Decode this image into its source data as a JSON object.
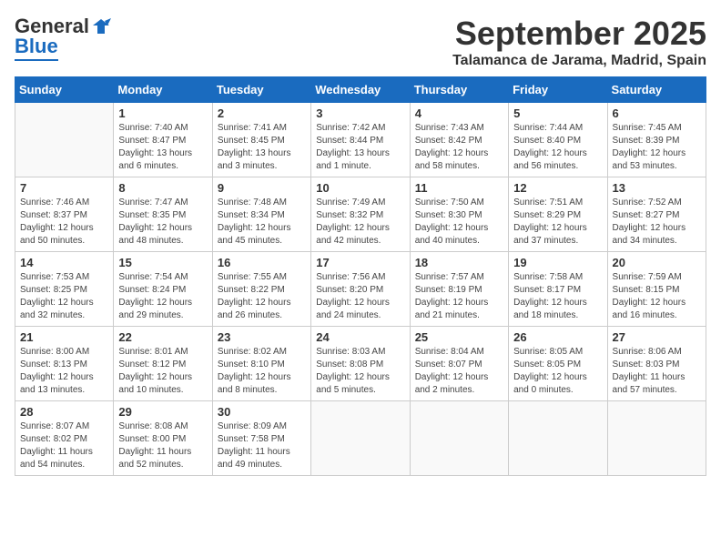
{
  "header": {
    "logo_general": "General",
    "logo_blue": "Blue",
    "month": "September 2025",
    "location": "Talamanca de Jarama, Madrid, Spain"
  },
  "weekdays": [
    "Sunday",
    "Monday",
    "Tuesday",
    "Wednesday",
    "Thursday",
    "Friday",
    "Saturday"
  ],
  "weeks": [
    [
      {
        "num": "",
        "empty": true
      },
      {
        "num": "1",
        "sunrise": "Sunrise: 7:40 AM",
        "sunset": "Sunset: 8:47 PM",
        "daylight": "Daylight: 13 hours and 6 minutes."
      },
      {
        "num": "2",
        "sunrise": "Sunrise: 7:41 AM",
        "sunset": "Sunset: 8:45 PM",
        "daylight": "Daylight: 13 hours and 3 minutes."
      },
      {
        "num": "3",
        "sunrise": "Sunrise: 7:42 AM",
        "sunset": "Sunset: 8:44 PM",
        "daylight": "Daylight: 13 hours and 1 minute."
      },
      {
        "num": "4",
        "sunrise": "Sunrise: 7:43 AM",
        "sunset": "Sunset: 8:42 PM",
        "daylight": "Daylight: 12 hours and 58 minutes."
      },
      {
        "num": "5",
        "sunrise": "Sunrise: 7:44 AM",
        "sunset": "Sunset: 8:40 PM",
        "daylight": "Daylight: 12 hours and 56 minutes."
      },
      {
        "num": "6",
        "sunrise": "Sunrise: 7:45 AM",
        "sunset": "Sunset: 8:39 PM",
        "daylight": "Daylight: 12 hours and 53 minutes."
      }
    ],
    [
      {
        "num": "7",
        "sunrise": "Sunrise: 7:46 AM",
        "sunset": "Sunset: 8:37 PM",
        "daylight": "Daylight: 12 hours and 50 minutes."
      },
      {
        "num": "8",
        "sunrise": "Sunrise: 7:47 AM",
        "sunset": "Sunset: 8:35 PM",
        "daylight": "Daylight: 12 hours and 48 minutes."
      },
      {
        "num": "9",
        "sunrise": "Sunrise: 7:48 AM",
        "sunset": "Sunset: 8:34 PM",
        "daylight": "Daylight: 12 hours and 45 minutes."
      },
      {
        "num": "10",
        "sunrise": "Sunrise: 7:49 AM",
        "sunset": "Sunset: 8:32 PM",
        "daylight": "Daylight: 12 hours and 42 minutes."
      },
      {
        "num": "11",
        "sunrise": "Sunrise: 7:50 AM",
        "sunset": "Sunset: 8:30 PM",
        "daylight": "Daylight: 12 hours and 40 minutes."
      },
      {
        "num": "12",
        "sunrise": "Sunrise: 7:51 AM",
        "sunset": "Sunset: 8:29 PM",
        "daylight": "Daylight: 12 hours and 37 minutes."
      },
      {
        "num": "13",
        "sunrise": "Sunrise: 7:52 AM",
        "sunset": "Sunset: 8:27 PM",
        "daylight": "Daylight: 12 hours and 34 minutes."
      }
    ],
    [
      {
        "num": "14",
        "sunrise": "Sunrise: 7:53 AM",
        "sunset": "Sunset: 8:25 PM",
        "daylight": "Daylight: 12 hours and 32 minutes."
      },
      {
        "num": "15",
        "sunrise": "Sunrise: 7:54 AM",
        "sunset": "Sunset: 8:24 PM",
        "daylight": "Daylight: 12 hours and 29 minutes."
      },
      {
        "num": "16",
        "sunrise": "Sunrise: 7:55 AM",
        "sunset": "Sunset: 8:22 PM",
        "daylight": "Daylight: 12 hours and 26 minutes."
      },
      {
        "num": "17",
        "sunrise": "Sunrise: 7:56 AM",
        "sunset": "Sunset: 8:20 PM",
        "daylight": "Daylight: 12 hours and 24 minutes."
      },
      {
        "num": "18",
        "sunrise": "Sunrise: 7:57 AM",
        "sunset": "Sunset: 8:19 PM",
        "daylight": "Daylight: 12 hours and 21 minutes."
      },
      {
        "num": "19",
        "sunrise": "Sunrise: 7:58 AM",
        "sunset": "Sunset: 8:17 PM",
        "daylight": "Daylight: 12 hours and 18 minutes."
      },
      {
        "num": "20",
        "sunrise": "Sunrise: 7:59 AM",
        "sunset": "Sunset: 8:15 PM",
        "daylight": "Daylight: 12 hours and 16 minutes."
      }
    ],
    [
      {
        "num": "21",
        "sunrise": "Sunrise: 8:00 AM",
        "sunset": "Sunset: 8:13 PM",
        "daylight": "Daylight: 12 hours and 13 minutes."
      },
      {
        "num": "22",
        "sunrise": "Sunrise: 8:01 AM",
        "sunset": "Sunset: 8:12 PM",
        "daylight": "Daylight: 12 hours and 10 minutes."
      },
      {
        "num": "23",
        "sunrise": "Sunrise: 8:02 AM",
        "sunset": "Sunset: 8:10 PM",
        "daylight": "Daylight: 12 hours and 8 minutes."
      },
      {
        "num": "24",
        "sunrise": "Sunrise: 8:03 AM",
        "sunset": "Sunset: 8:08 PM",
        "daylight": "Daylight: 12 hours and 5 minutes."
      },
      {
        "num": "25",
        "sunrise": "Sunrise: 8:04 AM",
        "sunset": "Sunset: 8:07 PM",
        "daylight": "Daylight: 12 hours and 2 minutes."
      },
      {
        "num": "26",
        "sunrise": "Sunrise: 8:05 AM",
        "sunset": "Sunset: 8:05 PM",
        "daylight": "Daylight: 12 hours and 0 minutes."
      },
      {
        "num": "27",
        "sunrise": "Sunrise: 8:06 AM",
        "sunset": "Sunset: 8:03 PM",
        "daylight": "Daylight: 11 hours and 57 minutes."
      }
    ],
    [
      {
        "num": "28",
        "sunrise": "Sunrise: 8:07 AM",
        "sunset": "Sunset: 8:02 PM",
        "daylight": "Daylight: 11 hours and 54 minutes."
      },
      {
        "num": "29",
        "sunrise": "Sunrise: 8:08 AM",
        "sunset": "Sunset: 8:00 PM",
        "daylight": "Daylight: 11 hours and 52 minutes."
      },
      {
        "num": "30",
        "sunrise": "Sunrise: 8:09 AM",
        "sunset": "Sunset: 7:58 PM",
        "daylight": "Daylight: 11 hours and 49 minutes."
      },
      {
        "num": "",
        "empty": true
      },
      {
        "num": "",
        "empty": true
      },
      {
        "num": "",
        "empty": true
      },
      {
        "num": "",
        "empty": true
      }
    ]
  ]
}
